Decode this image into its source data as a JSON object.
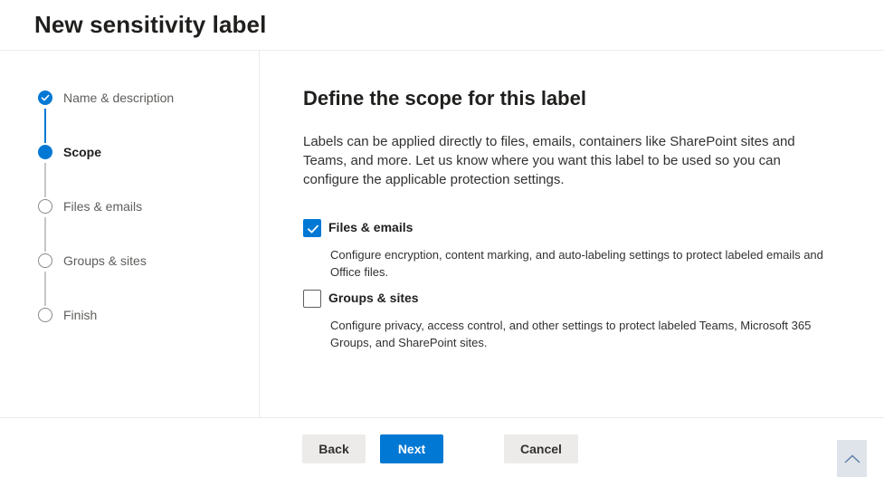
{
  "header": {
    "title": "New sensitivity label"
  },
  "steps": [
    {
      "label": "Name & description",
      "state": "done"
    },
    {
      "label": "Scope",
      "state": "current"
    },
    {
      "label": "Files & emails",
      "state": "todo"
    },
    {
      "label": "Groups & sites",
      "state": "todo"
    },
    {
      "label": "Finish",
      "state": "todo"
    }
  ],
  "main": {
    "heading": "Define the scope for this label",
    "intro": "Labels can be applied directly to files, emails, containers like SharePoint sites and Teams, and more. Let us know where you want this label to be used so you can configure the applicable protection settings.",
    "options": [
      {
        "title": "Files & emails",
        "checked": true,
        "description": "Configure encryption, content marking, and auto-labeling settings to protect labeled emails and Office files."
      },
      {
        "title": "Groups & sites",
        "checked": false,
        "description": "Configure privacy, access control, and other settings to protect labeled Teams, Microsoft 365 Groups, and SharePoint sites."
      }
    ]
  },
  "footer": {
    "back_label": "Back",
    "next_label": "Next",
    "cancel_label": "Cancel"
  },
  "icons": {
    "check": "check-icon",
    "scroll_top": "chevron-up-icon"
  },
  "colors": {
    "accent": "#0078d4",
    "secondary_button": "#edebe9"
  }
}
